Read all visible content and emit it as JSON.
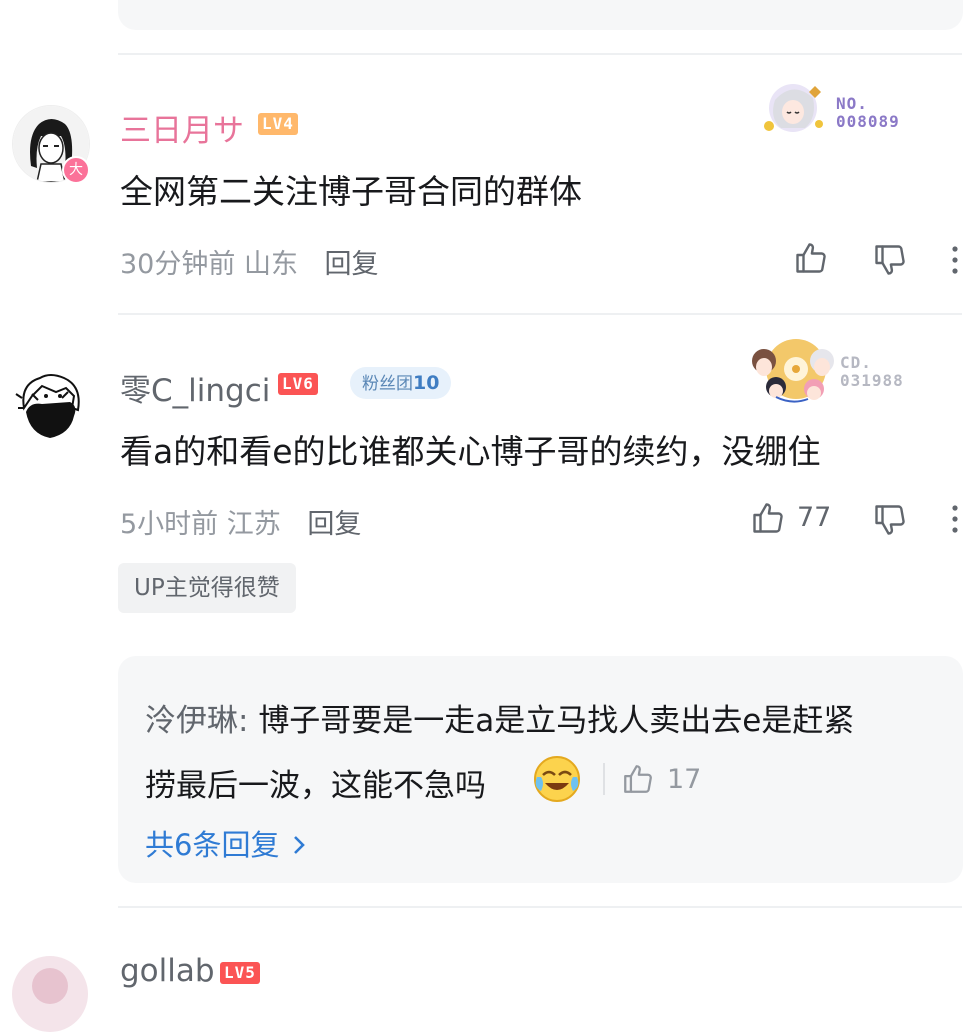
{
  "comments": [
    {
      "username": "三日月サ",
      "username_color": "#e8749a",
      "level": "LV4",
      "level_color": "#ffb86b",
      "avatar_badge": "大",
      "text": "全网第二关注博子哥合同的群体",
      "time": "30分钟前",
      "location": "山东",
      "reply_label": "回复",
      "like_count": "",
      "badge_card": {
        "line1": "NO.",
        "line2": "008089",
        "color": "#8b79c7"
      }
    },
    {
      "username": "零C_lingci",
      "username_color": "#61666d",
      "level": "LV6",
      "level_color": "#fb5454",
      "fans_label": "粉丝团",
      "fans_level": "10",
      "text": "看a的和看e的比谁都关心博子哥的续约，没绷住",
      "time": "5小时前",
      "location": "江苏",
      "reply_label": "回复",
      "like_count": "77",
      "up_tag": "UP主觉得很赞",
      "badge_card": {
        "line1": "CD.",
        "line2": "031988",
        "color": "#b6b8c2"
      },
      "reply": {
        "author": "泠伊琳",
        "line1": "博子哥要是一走a是立马找人卖出去e是赶紧",
        "line2": "捞最后一波，这能不急吗",
        "like_count": "17",
        "more_label": "共6条回复"
      }
    },
    {
      "username": "gollab",
      "level": "LV5",
      "level_color": "#fb5454"
    }
  ]
}
